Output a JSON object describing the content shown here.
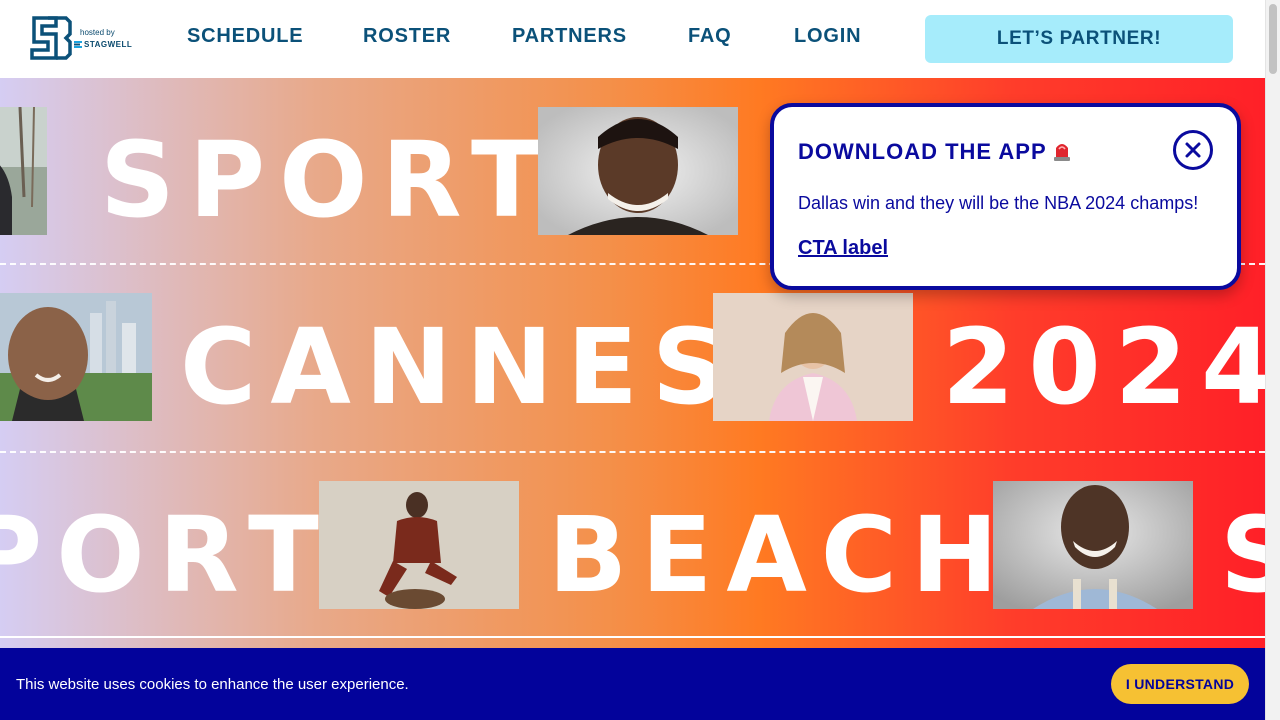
{
  "header": {
    "logo_text": "SB",
    "hosted_by": "hosted by",
    "host_brand": "STAGWELL",
    "nav": [
      {
        "label": "SCHEDULE"
      },
      {
        "label": "ROSTER"
      },
      {
        "label": "PARTNERS"
      },
      {
        "label": "FAQ"
      },
      {
        "label": "LOGIN"
      }
    ],
    "cta_label": "LET’S PARTNER!"
  },
  "hero": {
    "row1_word": "SPORT",
    "row2_word1": "CANNES",
    "row2_word2": "2024",
    "row3_word1": "PORT",
    "row3_word2": "BEACH",
    "row3_word3": "S"
  },
  "popup": {
    "title": "DOWNLOAD THE APP",
    "title_icon": "siren-icon",
    "text": "Dallas win and they will be the NBA 2024 champs!",
    "link_label": "CTA label",
    "close_icon": "close-icon"
  },
  "cookie": {
    "text": "This website uses cookies to enhance the user experience.",
    "button_label": "I UNDERSTAND"
  },
  "colors": {
    "nav": "#0b5179",
    "cta_bg": "#a6ecfb",
    "popup_accent": "#0a0a9e",
    "cookie_bg": "#03039b",
    "cookie_btn": "#f6c133"
  }
}
